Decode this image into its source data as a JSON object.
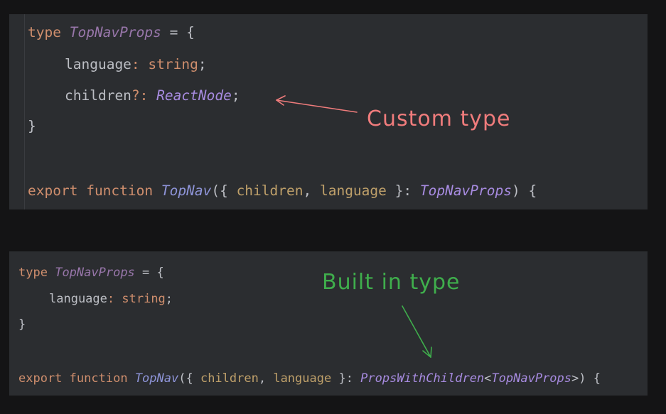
{
  "snippet1": {
    "line1": {
      "kw": "type",
      "name": "TopNavProps",
      "eq": " = {"
    },
    "line2": {
      "prop": "language",
      "colon": ": ",
      "type": "string",
      "semi": ";"
    },
    "line3": {
      "prop": "children",
      "opt": "?: ",
      "type": "ReactNode",
      "semi": ";"
    },
    "line4": {
      "brace": "}"
    },
    "line5": {
      "kw1": "export",
      "kw2": "function",
      "fn": "TopNav",
      "open": "({ ",
      "p1": "children",
      "comma": ", ",
      "p2": "language",
      "close": " }: ",
      "type": "TopNavProps",
      "end": ") {"
    }
  },
  "snippet2": {
    "line1": {
      "kw": "type",
      "name": "TopNavProps",
      "eq": " = {"
    },
    "line2": {
      "prop": "language",
      "colon": ": ",
      "type": "string",
      "semi": ";"
    },
    "line3": {
      "brace": "}"
    },
    "line4": {
      "kw1": "export",
      "kw2": "function",
      "fn": "TopNav",
      "open": "({ ",
      "p1": "children",
      "comma": ", ",
      "p2": "language",
      "close": " }: ",
      "generic": "PropsWithChildren",
      "lt": "<",
      "type": "TopNavProps",
      "gt": ">",
      "end": ") {"
    }
  },
  "annotations": {
    "custom": "Custom type",
    "builtin": "Built in type"
  },
  "colors": {
    "background": "#141415",
    "panel": "#2b2d30",
    "keyword": "#cf8e6d",
    "type": "#9876aa",
    "function": "#8e94d8",
    "parameter": "#bfa06a",
    "custom_annotation": "#f07c7c",
    "builtin_annotation": "#3fae4c"
  }
}
